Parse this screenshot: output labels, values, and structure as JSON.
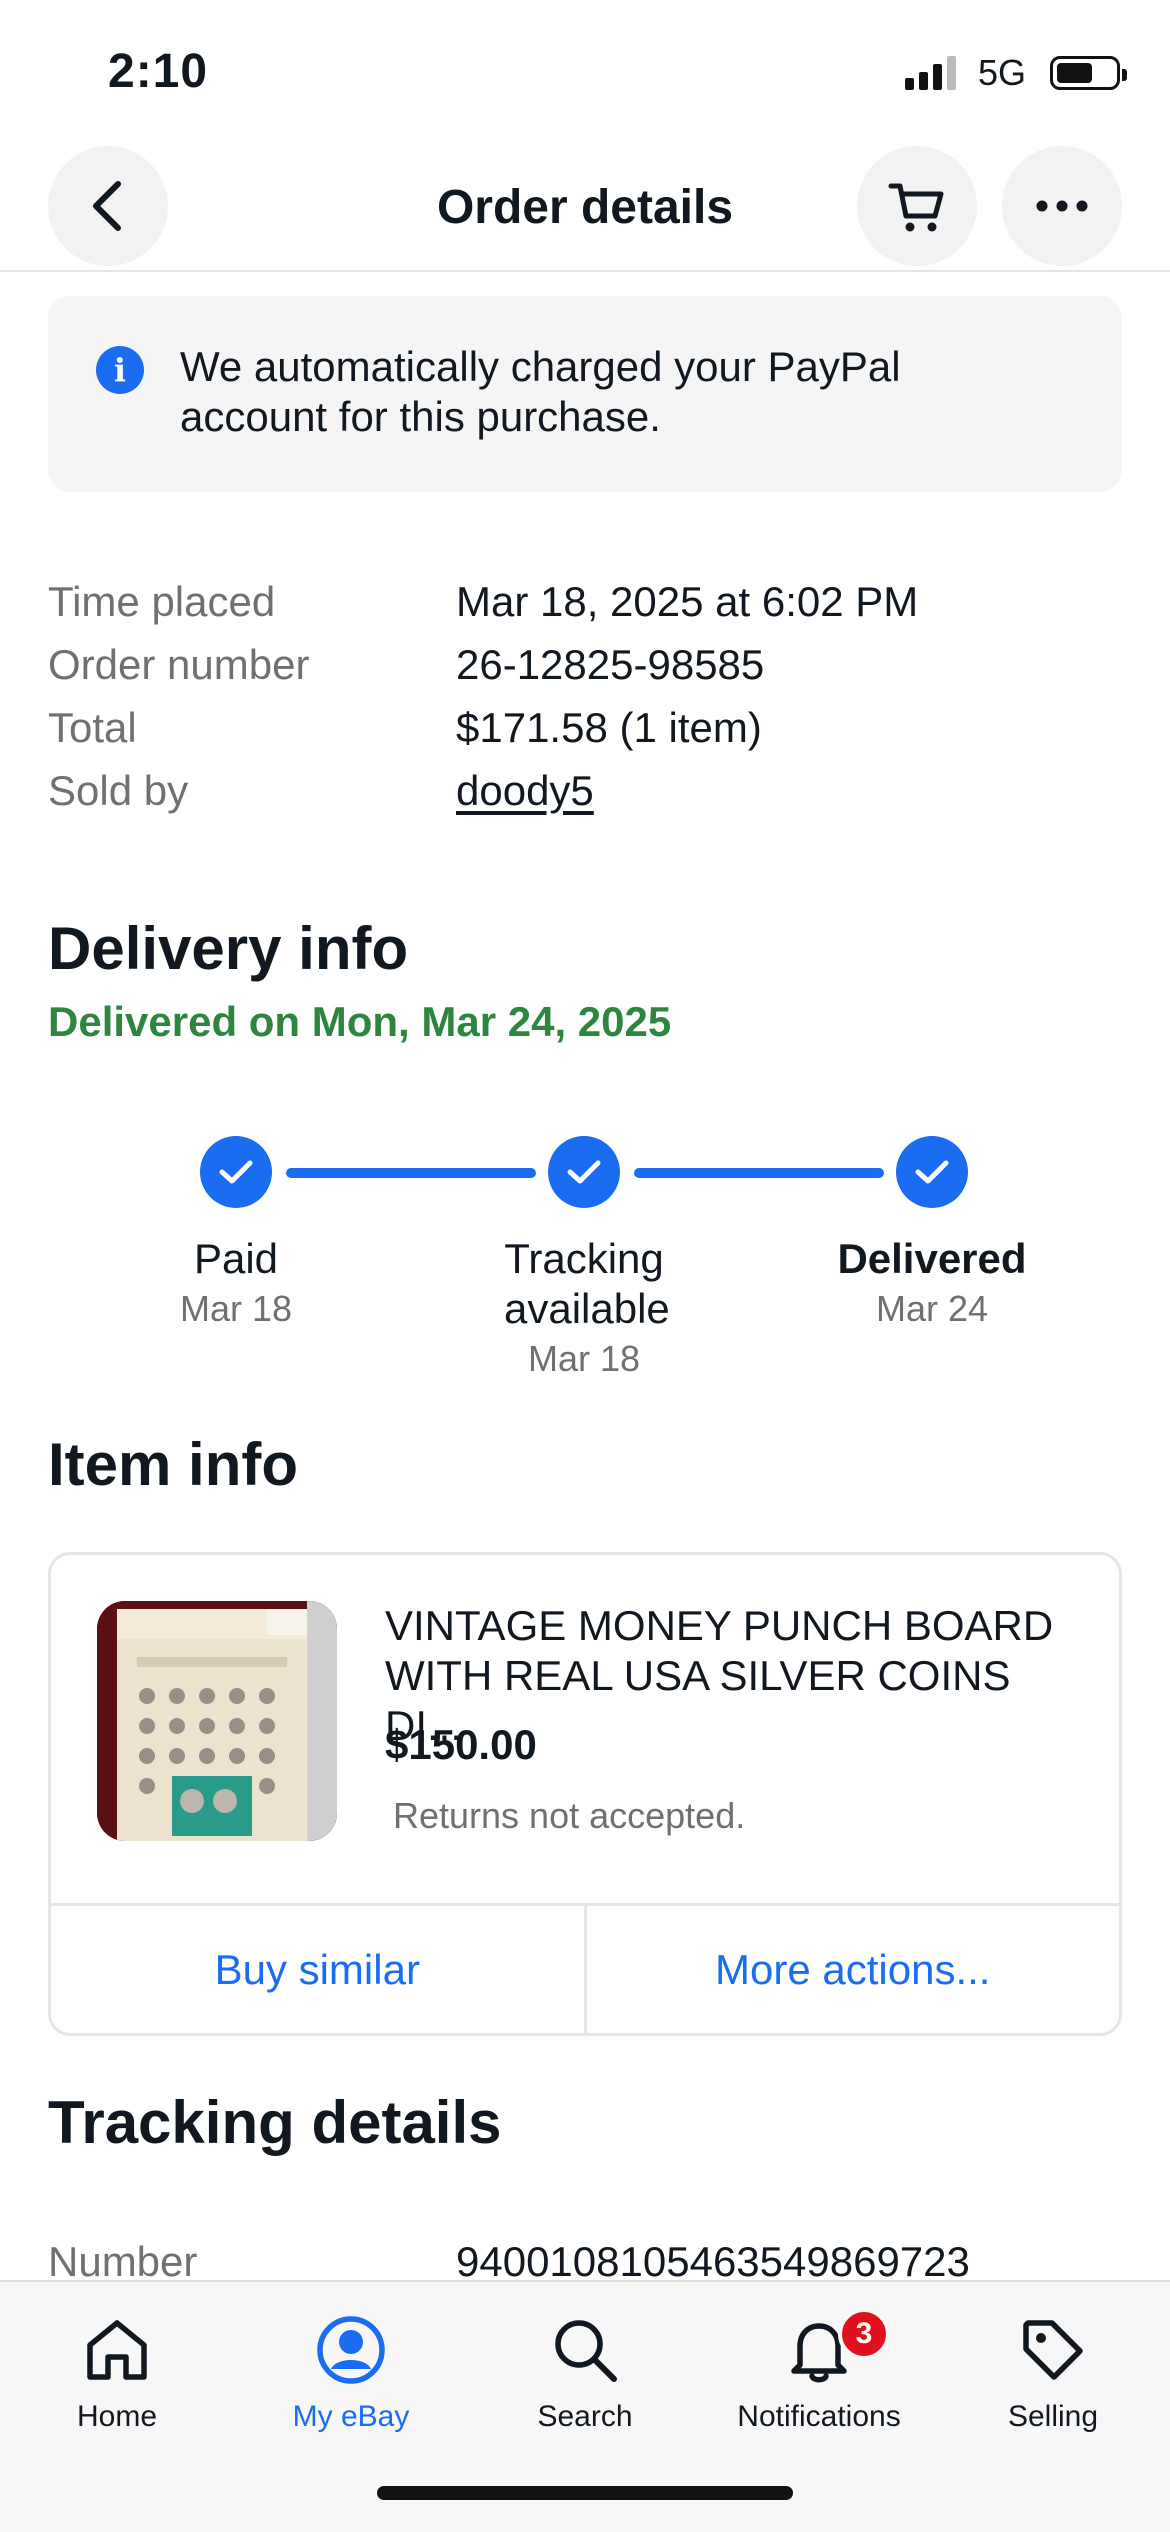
{
  "status_bar": {
    "time": "2:10",
    "network": "5G"
  },
  "header": {
    "title": "Order details"
  },
  "banner": {
    "text": "We automatically charged your PayPal account for this purchase."
  },
  "order": [
    {
      "label": "Time placed",
      "value": "Mar 18, 2025 at 6:02 PM"
    },
    {
      "label": "Order number",
      "value": "26-12825-98585"
    },
    {
      "label": "Total",
      "value": "$171.58 (1 item)"
    },
    {
      "label": "Sold by",
      "value": "doody5"
    }
  ],
  "delivery": {
    "title": "Delivery info",
    "status": "Delivered on Mon, Mar 24, 2025",
    "steps": [
      {
        "label": "Paid",
        "date": "Mar 18"
      },
      {
        "label": "Tracking available",
        "date": "Mar 18"
      },
      {
        "label": "Delivered",
        "date": "Mar 24"
      }
    ]
  },
  "item": {
    "section_title": "Item info",
    "name": "VINTAGE MONEY PUNCH BOARD WITH REAL USA SILVER COINS DI...",
    "price": "$150.00",
    "returns": "Returns not accepted.",
    "buy_similar": "Buy similar",
    "more_actions": "More actions..."
  },
  "tracking": {
    "title": "Tracking details",
    "number_label": "Number",
    "number_value": "9400108105463549869723"
  },
  "tabs": [
    {
      "label": "Home",
      "icon": "home-icon"
    },
    {
      "label": "My eBay",
      "icon": "profile-icon",
      "active": true
    },
    {
      "label": "Search",
      "icon": "search-icon"
    },
    {
      "label": "Notifications",
      "icon": "bell-icon",
      "badge": "3"
    },
    {
      "label": "Selling",
      "icon": "tag-icon"
    }
  ],
  "colors": {
    "accent": "#1a6cf0",
    "success": "#2e8540",
    "badge": "#e0101c"
  }
}
